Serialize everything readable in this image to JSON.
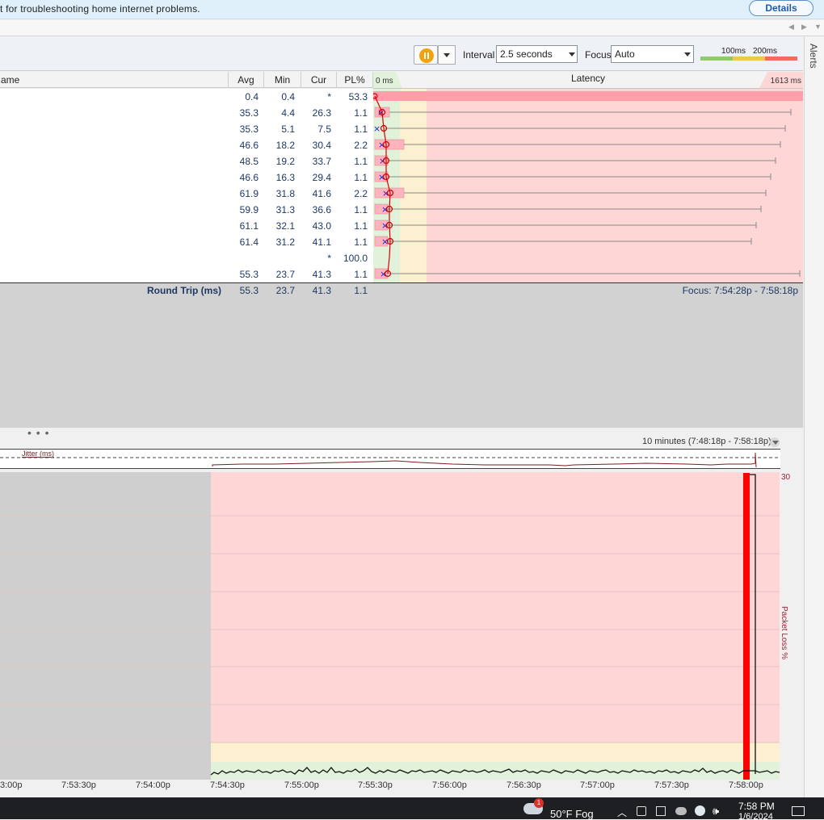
{
  "banner": {
    "text": "t for troubleshooting home internet problems.",
    "details_label": "Details"
  },
  "toolbar": {
    "interval_label": "Interval",
    "interval_value": "2.5 seconds",
    "focus_label": "Focus",
    "focus_value": "Auto",
    "legend_100": "100ms",
    "legend_200": "200ms",
    "alerts_label": "Alerts"
  },
  "grid": {
    "headers": {
      "name": "ame",
      "avg": "Avg",
      "min": "Min",
      "cur": "Cur",
      "pl": "PL%"
    },
    "rows": [
      {
        "avg": "0.4",
        "min": "0.4",
        "cur": "*",
        "pl": "53.3"
      },
      {
        "avg": "35.3",
        "min": "4.4",
        "cur": "26.3",
        "pl": "1.1"
      },
      {
        "avg": "35.3",
        "min": "5.1",
        "cur": "7.5",
        "pl": "1.1"
      },
      {
        "avg": "46.6",
        "min": "18.2",
        "cur": "30.4",
        "pl": "2.2"
      },
      {
        "avg": "48.5",
        "min": "19.2",
        "cur": "33.7",
        "pl": "1.1"
      },
      {
        "avg": "46.6",
        "min": "16.3",
        "cur": "29.4",
        "pl": "1.1"
      },
      {
        "avg": "61.9",
        "min": "31.8",
        "cur": "41.6",
        "pl": "2.2"
      },
      {
        "avg": "59.9",
        "min": "31.3",
        "cur": "36.6",
        "pl": "1.1"
      },
      {
        "avg": "61.1",
        "min": "32.1",
        "cur": "43.0",
        "pl": "1.1"
      },
      {
        "avg": "61.4",
        "min": "31.2",
        "cur": "41.1",
        "pl": "1.1"
      },
      {
        "avg": "",
        "min": "",
        "cur": "*",
        "pl": "100.0"
      },
      {
        "avg": "55.3",
        "min": "23.7",
        "cur": "41.3",
        "pl": "1.1"
      }
    ],
    "round_trip": {
      "label": "Round Trip (ms)",
      "avg": "55.3",
      "min": "23.7",
      "cur": "41.3",
      "pl": "1.1"
    }
  },
  "latency_panel": {
    "title": "Latency",
    "min_label": "0 ms",
    "max_label": "1613 ms",
    "focus_range": "Focus: 7:54:28p - 7:58:18p"
  },
  "timeline": {
    "range_label": "10 minutes (7:48:18p - 7:58:18p)",
    "jitter_label": "Jitter (ms)",
    "y_max_label": "30",
    "y_axis_title": "Packet Loss %",
    "x_ticks": [
      "3:00p",
      "7:53:30p",
      "7:54:00p",
      "7:54:30p",
      "7:55:00p",
      "7:55:30p",
      "7:56:00p",
      "7:56:30p",
      "7:57:00p",
      "7:57:30p",
      "7:58:00p"
    ]
  },
  "taskbar": {
    "weather": "50°F  Fog",
    "time": "7:58 PM",
    "date": "1/6/2024",
    "notify_count": "1"
  },
  "colors": {
    "bad": "#ffd6d6",
    "warn": "#fdf0d0",
    "good": "#e1f1da",
    "accent": "#f2a20c",
    "loss": "#ff0000"
  }
}
